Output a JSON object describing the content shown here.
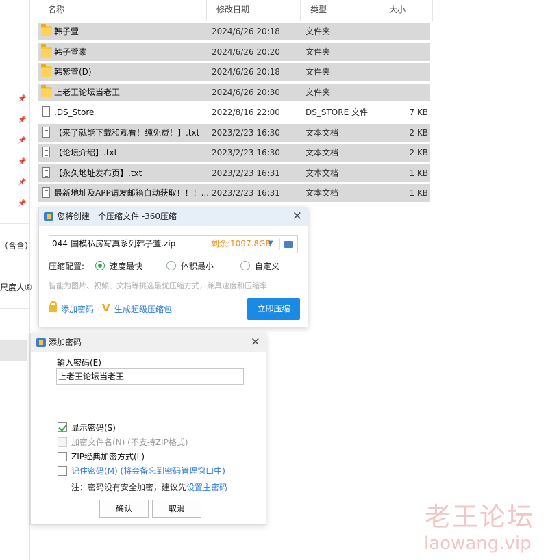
{
  "columns": {
    "name": "名称",
    "modified": "修改日期",
    "type": "类型",
    "size": "大小"
  },
  "files": [
    {
      "name": "韩子萱",
      "date": "2024/6/26 20:18",
      "type": "文件夹",
      "size": "",
      "icon": "folder-icon",
      "selected": true
    },
    {
      "name": "韩子萱素",
      "date": "2024/6/26 20:20",
      "type": "文件夹",
      "size": "",
      "icon": "folder-icon",
      "selected": true
    },
    {
      "name": "韩紫萱(D)",
      "date": "2024/6/26 20:18",
      "type": "文件夹",
      "size": "",
      "icon": "folder-icon",
      "selected": true
    },
    {
      "name": "上老王论坛当老王",
      "date": "2024/6/26 20:30",
      "type": "文件夹",
      "size": "",
      "icon": "folder-icon",
      "selected": true
    },
    {
      "name": ".DS_Store",
      "date": "2022/8/16 22:00",
      "type": "DS_STORE 文件",
      "size": "7 KB",
      "icon": "file-icon",
      "selected": false
    },
    {
      "name": "【来了就能下载和观看！纯免费！】.txt",
      "date": "2023/2/23 16:30",
      "type": "文本文档",
      "size": "2 KB",
      "icon": "text-file-icon",
      "selected": true
    },
    {
      "name": "【论坛介绍】.txt",
      "date": "2023/2/23 16:30",
      "type": "文本文档",
      "size": "2 KB",
      "icon": "text-file-icon",
      "selected": true
    },
    {
      "name": "【永久地址发布页】.txt",
      "date": "2023/2/23 16:31",
      "type": "文本文档",
      "size": "1 KB",
      "icon": "text-file-icon",
      "selected": true
    },
    {
      "name": "最新地址及APP请发邮箱自动获取！！！....",
      "date": "2023/2/23 16:31",
      "type": "文本文档",
      "size": "1 KB",
      "icon": "text-file-icon",
      "selected": true
    }
  ],
  "nav": {
    "text1": "（含含）",
    "text2": "尺度人⑥"
  },
  "compress_dialog": {
    "title": "您将创建一个压缩文件 -360压缩",
    "filename": "044-国模私房写真系列韩子萱.zip",
    "free_space": "剩余:1097.8GB",
    "option_label": "压缩配置:",
    "options": [
      "速度最快",
      "体积最小",
      "自定义"
    ],
    "selected_option": "速度最快",
    "hint": "智能为图片、视频、文档等挑选最优压缩方式，兼具速度和压缩率",
    "add_password": "添加密码",
    "super_pack": "生成超级压缩包",
    "compress_button": "立即压缩"
  },
  "password_dialog": {
    "title": "添加密码",
    "input_label": "输入密码(E)",
    "password_value": "上老王论坛当老王",
    "show_password": "显示密码(S)",
    "show_password_checked": true,
    "encrypt_names": "加密文件名(N) (不支持ZIP格式)",
    "zip_classic": "ZIP经典加密方式(L)",
    "remember": "记住密码(M) (将会备忘到密码管理窗口中)",
    "note_prefix": "注：密码没有安全加密，建议先",
    "note_link": "设置主密码",
    "ok": "确认",
    "cancel": "取消"
  },
  "watermark": {
    "line1": "老王论坛",
    "line2": "laowang.vip"
  }
}
